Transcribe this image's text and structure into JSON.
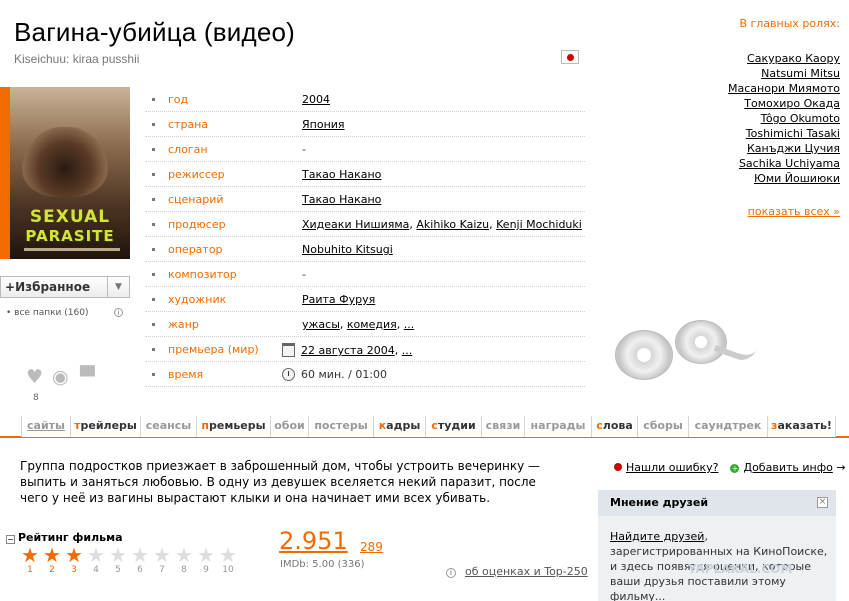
{
  "film": {
    "title": "Вагина-убийца (видео)",
    "original_title": "Kiseichuu: kiraa pusshii",
    "country_flag": "japan-flag"
  },
  "poster": {
    "line1": "SEXUAL",
    "line2": "PARASITE"
  },
  "favorites": {
    "button_label": "Избранное",
    "plus": "+",
    "dropdown": "▼",
    "folders_label": "все папки (160)",
    "info_icon": "i"
  },
  "stats": {
    "likes": "8"
  },
  "info_rows": [
    {
      "key": "год",
      "value": "2004"
    },
    {
      "key": "страна",
      "value": "Япония"
    },
    {
      "key": "слоган",
      "value": "-"
    },
    {
      "key": "режиссер",
      "value": "Такао Накано"
    },
    {
      "key": "сценарий",
      "value": "Такао Накано"
    },
    {
      "key": "продюсер",
      "values": [
        "Хидеаки Нишияма",
        "Akihiko Kaizu",
        "Kenji Mochiduki"
      ]
    },
    {
      "key": "оператор",
      "value": "Nobuhito Kitsugi"
    },
    {
      "key": "композитор",
      "value": "-"
    },
    {
      "key": "художник",
      "value": "Раита Фуруя"
    },
    {
      "key": "жанр",
      "values": [
        "ужасы",
        "комедия",
        "..."
      ]
    },
    {
      "key": "премьера (мир)",
      "values": [
        "22 августа 2004",
        "..."
      ]
    },
    {
      "key": "время",
      "value": "60 мин. / 01:00"
    }
  ],
  "actors": {
    "heading": "В главных ролях:",
    "list": [
      "Сакурако Каору",
      "Natsumi Mitsu",
      "Масанори Миямото",
      "Томохиро Окада",
      "Tôgo Okumoto",
      "Toshimichi Tasaki",
      "Канъджи Цучия",
      "Sachika Uchiyama",
      "Юми Йошиюки"
    ],
    "show_all": "показать всех »"
  },
  "tabs": [
    {
      "pre": "",
      "hl": "",
      "rest": "сайты"
    },
    {
      "pre": "",
      "hl": "т",
      "rest": "рейлеры"
    },
    {
      "pre": "",
      "hl": "",
      "rest": "сеансы"
    },
    {
      "pre": "",
      "hl": "п",
      "rest": "ремьеры"
    },
    {
      "pre": "",
      "hl": "",
      "rest": "обои"
    },
    {
      "pre": "",
      "hl": "",
      "rest": "постеры"
    },
    {
      "pre": "",
      "hl": "к",
      "rest": "адры"
    },
    {
      "pre": "",
      "hl": "с",
      "rest": "тудии"
    },
    {
      "pre": "",
      "hl": "",
      "rest": "связи"
    },
    {
      "pre": "",
      "hl": "",
      "rest": "награды"
    },
    {
      "pre": "",
      "hl": "с",
      "rest": "лова"
    },
    {
      "pre": "",
      "hl": "",
      "rest": "сборы"
    },
    {
      "pre": "",
      "hl": "",
      "rest": "саундтрек"
    },
    {
      "pre": "",
      "hl": "з",
      "rest": "аказать!"
    }
  ],
  "description": "Группа подростков приезжает в заброшенный дом, чтобы устроить вечеринку — выпить и заняться любовью. В одну из девушек вселяется некий паразит, после чего у неё из вагины вырастают клыки и она начинает ими всех убивать.",
  "side_links": {
    "report_error": "Нашли ошибку?",
    "add_info": "Добавить инфо",
    "arrow": "→"
  },
  "friends": {
    "heading": "Мнение друзей",
    "close": "×",
    "link": "Найдите друзей",
    "text": ", зарегистрированных на КиноПоиске, и здесь появятся оценки, которые ваши друзья поставили этому фильму...",
    "watermark": "YAPLAKAL.COM"
  },
  "rating": {
    "heading": "Рейтинг фильма",
    "toggle": "−",
    "stars_total": 10,
    "stars_filled": 3,
    "score": "2.951",
    "votes": "289",
    "imdb": "IMDb: 5.00 (336)",
    "about_link": "об оценках и Top-250",
    "about_icon": "i"
  },
  "colors": {
    "accent": "#f26b00"
  }
}
